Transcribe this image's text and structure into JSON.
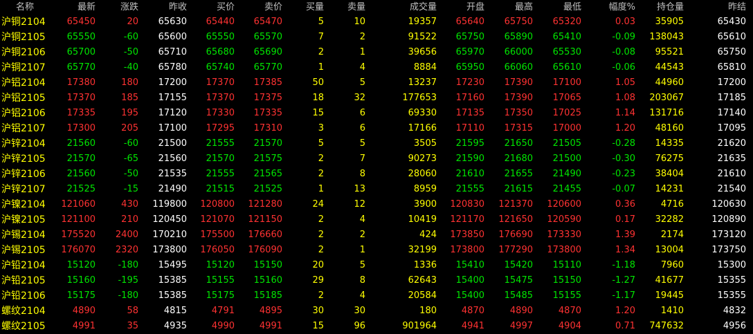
{
  "colors": {
    "up": "#ff3232",
    "down": "#00e600",
    "neutral": "#ffffff",
    "volume": "#ffff00",
    "header": "#c0c0c0",
    "background": "#000000"
  },
  "headers": [
    "名称",
    "最新",
    "涨跌",
    "昨收",
    "买价",
    "卖价",
    "买量",
    "卖量",
    "成交量",
    "开盘",
    "最高",
    "最低",
    "幅度%",
    "持仓量",
    "昨结"
  ],
  "rows": [
    {
      "name": "沪铜",
      "code": "2104",
      "last": "65450",
      "chg": "20",
      "prev": "65630",
      "bid": "65440",
      "ask": "65470",
      "bidv": "5",
      "askv": "10",
      "vol": "19357",
      "open": "65640",
      "high": "65750",
      "low": "65320",
      "pct": "0.03",
      "oi": "35905",
      "settle": "65430",
      "dir": "up"
    },
    {
      "name": "沪铜",
      "code": "2105",
      "last": "65550",
      "chg": "-60",
      "prev": "65600",
      "bid": "65550",
      "ask": "65570",
      "bidv": "7",
      "askv": "2",
      "vol": "91522",
      "open": "65750",
      "high": "65890",
      "low": "65410",
      "pct": "-0.09",
      "oi": "138043",
      "settle": "65610",
      "dir": "down"
    },
    {
      "name": "沪铜",
      "code": "2106",
      "last": "65700",
      "chg": "-50",
      "prev": "65710",
      "bid": "65680",
      "ask": "65690",
      "bidv": "2",
      "askv": "1",
      "vol": "39656",
      "open": "65970",
      "high": "66000",
      "low": "65530",
      "pct": "-0.08",
      "oi": "95521",
      "settle": "65750",
      "dir": "down"
    },
    {
      "name": "沪铜",
      "code": "2107",
      "last": "65770",
      "chg": "-40",
      "prev": "65780",
      "bid": "65740",
      "ask": "65770",
      "bidv": "1",
      "askv": "4",
      "vol": "8884",
      "open": "65950",
      "high": "66060",
      "low": "65610",
      "pct": "-0.06",
      "oi": "44543",
      "settle": "65810",
      "dir": "down"
    },
    {
      "name": "沪铝",
      "code": "2104",
      "last": "17380",
      "chg": "180",
      "prev": "17200",
      "bid": "17370",
      "ask": "17385",
      "bidv": "50",
      "askv": "5",
      "vol": "13237",
      "open": "17230",
      "high": "17390",
      "low": "17100",
      "pct": "1.05",
      "oi": "44960",
      "settle": "17200",
      "dir": "up"
    },
    {
      "name": "沪铝",
      "code": "2105",
      "last": "17370",
      "chg": "185",
      "prev": "17155",
      "bid": "17370",
      "ask": "17375",
      "bidv": "18",
      "askv": "32",
      "vol": "177653",
      "open": "17160",
      "high": "17390",
      "low": "17065",
      "pct": "1.08",
      "oi": "203067",
      "settle": "17185",
      "dir": "up"
    },
    {
      "name": "沪铝",
      "code": "2106",
      "last": "17335",
      "chg": "195",
      "prev": "17120",
      "bid": "17330",
      "ask": "17335",
      "bidv": "15",
      "askv": "6",
      "vol": "69330",
      "open": "17135",
      "high": "17350",
      "low": "17025",
      "pct": "1.14",
      "oi": "131716",
      "settle": "17140",
      "dir": "up"
    },
    {
      "name": "沪铝",
      "code": "2107",
      "last": "17300",
      "chg": "205",
      "prev": "17100",
      "bid": "17295",
      "ask": "17310",
      "bidv": "3",
      "askv": "6",
      "vol": "17166",
      "open": "17110",
      "high": "17315",
      "low": "17000",
      "pct": "1.20",
      "oi": "48160",
      "settle": "17095",
      "dir": "up"
    },
    {
      "name": "沪锌",
      "code": "2104",
      "last": "21560",
      "chg": "-60",
      "prev": "21500",
      "bid": "21555",
      "ask": "21570",
      "bidv": "5",
      "askv": "5",
      "vol": "3505",
      "open": "21595",
      "high": "21650",
      "low": "21505",
      "pct": "-0.28",
      "oi": "14335",
      "settle": "21620",
      "dir": "down"
    },
    {
      "name": "沪锌",
      "code": "2105",
      "last": "21570",
      "chg": "-65",
      "prev": "21560",
      "bid": "21570",
      "ask": "21575",
      "bidv": "2",
      "askv": "7",
      "vol": "90273",
      "open": "21590",
      "high": "21680",
      "low": "21500",
      "pct": "-0.30",
      "oi": "76275",
      "settle": "21635",
      "dir": "down"
    },
    {
      "name": "沪锌",
      "code": "2106",
      "last": "21560",
      "chg": "-50",
      "prev": "21535",
      "bid": "21555",
      "ask": "21565",
      "bidv": "2",
      "askv": "8",
      "vol": "28060",
      "open": "21610",
      "high": "21655",
      "low": "21490",
      "pct": "-0.23",
      "oi": "38404",
      "settle": "21610",
      "dir": "down"
    },
    {
      "name": "沪锌",
      "code": "2107",
      "last": "21525",
      "chg": "-15",
      "prev": "21490",
      "bid": "21515",
      "ask": "21525",
      "bidv": "1",
      "askv": "13",
      "vol": "8959",
      "open": "21555",
      "high": "21615",
      "low": "21455",
      "pct": "-0.07",
      "oi": "14231",
      "settle": "21540",
      "dir": "down"
    },
    {
      "name": "沪镍",
      "code": "2104",
      "last": "121060",
      "chg": "430",
      "prev": "119800",
      "bid": "120800",
      "ask": "121280",
      "bidv": "24",
      "askv": "12",
      "vol": "3900",
      "open": "120830",
      "high": "121370",
      "low": "120600",
      "pct": "0.36",
      "oi": "4716",
      "settle": "120630",
      "dir": "up"
    },
    {
      "name": "沪镍",
      "code": "2105",
      "last": "121100",
      "chg": "210",
      "prev": "120450",
      "bid": "121070",
      "ask": "121150",
      "bidv": "2",
      "askv": "4",
      "vol": "10419",
      "open": "121170",
      "high": "121650",
      "low": "120590",
      "pct": "0.17",
      "oi": "32282",
      "settle": "120890",
      "dir": "up"
    },
    {
      "name": "沪锡",
      "code": "2104",
      "last": "175520",
      "chg": "2400",
      "prev": "170210",
      "bid": "175500",
      "ask": "176660",
      "bidv": "2",
      "askv": "2",
      "vol": "424",
      "open": "173850",
      "high": "176690",
      "low": "173330",
      "pct": "1.39",
      "oi": "2174",
      "settle": "173120",
      "dir": "up"
    },
    {
      "name": "沪锡",
      "code": "2105",
      "last": "176070",
      "chg": "2320",
      "prev": "173800",
      "bid": "176050",
      "ask": "176090",
      "bidv": "2",
      "askv": "1",
      "vol": "32199",
      "open": "173800",
      "high": "177290",
      "low": "173800",
      "pct": "1.34",
      "oi": "13004",
      "settle": "173750",
      "dir": "up"
    },
    {
      "name": "沪铅",
      "code": "2104",
      "last": "15120",
      "chg": "-180",
      "prev": "15495",
      "bid": "15120",
      "ask": "15150",
      "bidv": "20",
      "askv": "5",
      "vol": "1336",
      "open": "15410",
      "high": "15420",
      "low": "15110",
      "pct": "-1.18",
      "oi": "7960",
      "settle": "15300",
      "dir": "down"
    },
    {
      "name": "沪铅",
      "code": "2105",
      "last": "15160",
      "chg": "-195",
      "prev": "15385",
      "bid": "15155",
      "ask": "15160",
      "bidv": "29",
      "askv": "8",
      "vol": "62643",
      "open": "15400",
      "high": "15475",
      "low": "15150",
      "pct": "-1.27",
      "oi": "41677",
      "settle": "15355",
      "dir": "down"
    },
    {
      "name": "沪铅",
      "code": "2106",
      "last": "15175",
      "chg": "-180",
      "prev": "15385",
      "bid": "15175",
      "ask": "15185",
      "bidv": "2",
      "askv": "4",
      "vol": "20584",
      "open": "15400",
      "high": "15485",
      "low": "15155",
      "pct": "-1.17",
      "oi": "19445",
      "settle": "15355",
      "dir": "down"
    },
    {
      "name": "螺纹",
      "code": "2104",
      "last": "4890",
      "chg": "58",
      "prev": "4815",
      "bid": "4791",
      "ask": "4895",
      "bidv": "30",
      "askv": "30",
      "vol": "180",
      "open": "4870",
      "high": "4890",
      "low": "4870",
      "pct": "1.20",
      "oi": "1410",
      "settle": "4832",
      "dir": "up"
    },
    {
      "name": "螺纹",
      "code": "2105",
      "last": "4991",
      "chg": "35",
      "prev": "4935",
      "bid": "4990",
      "ask": "4991",
      "bidv": "15",
      "askv": "96",
      "vol": "901964",
      "open": "4941",
      "high": "4997",
      "low": "4904",
      "pct": "0.71",
      "oi": "747632",
      "settle": "4956",
      "dir": "up"
    }
  ]
}
